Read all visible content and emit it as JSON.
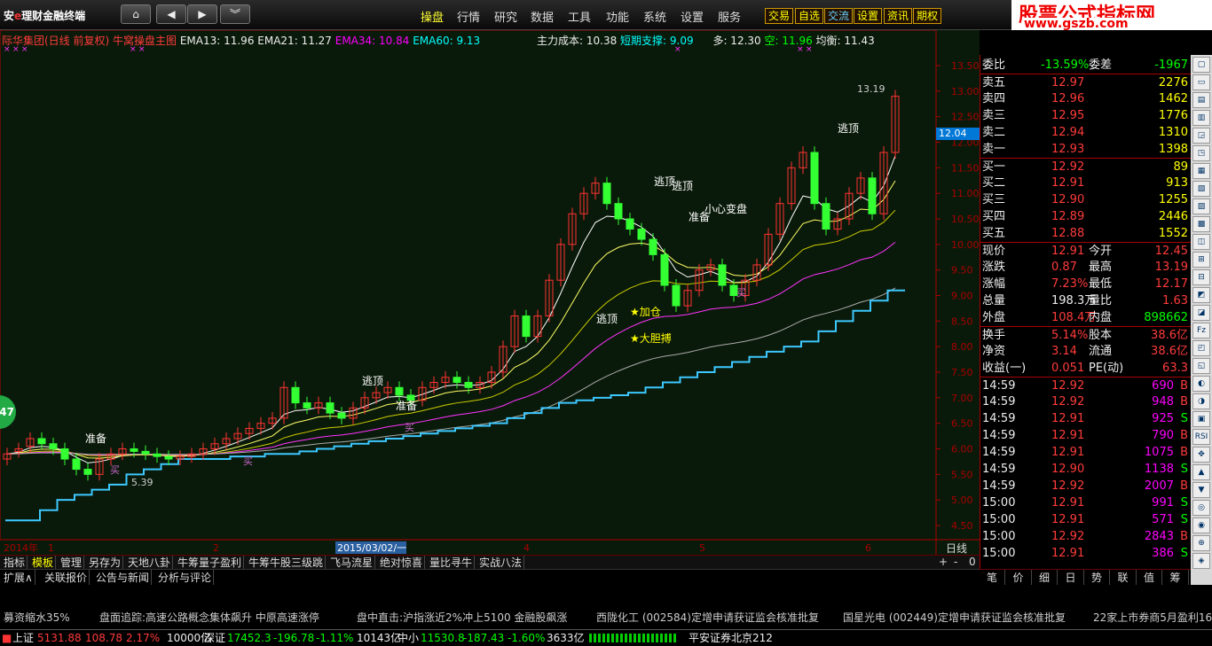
{
  "app": {
    "logo_prefix": "安",
    "logo_e": "e",
    "logo_text": "理财金融终端"
  },
  "menus": [
    "操盘",
    "行情",
    "研究",
    "数据",
    "工具",
    "功能",
    "系统",
    "设置",
    "服务"
  ],
  "active_menu": "操盘",
  "trade_buttons": [
    "交易",
    "自选",
    "交流",
    "设置",
    "资讯",
    "期权"
  ],
  "brand": {
    "line1": "股票公式指标网",
    "line2": "www.gszb.com"
  },
  "chart": {
    "title": "际华集团(日线 前复权) 牛窝操盘主图",
    "ema13": "EMA13: 11.96",
    "ema21": "EMA21: 11.27",
    "ema34": "EMA34: 10.84",
    "ema60": "EMA60: 9.13",
    "cost": "主力成本: 10.38",
    "support": "短期支撑: 9.09",
    "long": "多: 12.30",
    "short": "空: 11.96",
    "balance": "均衡: 11.43",
    "current_price_tag": "12.04",
    "period_label": "日线",
    "x_labels": [
      "2014年",
      "1",
      "2",
      "2015/03/02/一",
      "4",
      "5",
      "6"
    ],
    "annotations": {
      "escape": "逃顶",
      "prepare": "准备",
      "careful": "小心变盘",
      "add": "加仓",
      "bold": "大胆搏",
      "buy": "买",
      "high": "13.19",
      "low": "5.39"
    }
  },
  "chart_data": {
    "type": "candlestick",
    "ylim": [
      4.5,
      13.5
    ],
    "y_ticks": [
      "13.50",
      "13.00",
      "12.50",
      "12.00",
      "11.50",
      "11.00",
      "10.50",
      "10.00",
      "9.50",
      "9.00",
      "8.50",
      "8.00",
      "7.50",
      "7.00",
      "6.50",
      "6.00",
      "5.50",
      "5.00",
      "4.50"
    ],
    "close": [
      5.9,
      6.0,
      6.2,
      6.1,
      6.0,
      5.8,
      5.6,
      5.5,
      5.8,
      5.9,
      6.0,
      5.95,
      5.9,
      5.85,
      5.8,
      5.85,
      5.9,
      6.0,
      6.1,
      6.2,
      6.3,
      6.4,
      6.5,
      6.6,
      7.2,
      6.9,
      6.8,
      6.9,
      6.7,
      6.6,
      6.8,
      7.0,
      7.1,
      7.2,
      7.05,
      6.95,
      7.2,
      7.3,
      7.4,
      7.3,
      7.2,
      7.3,
      7.5,
      8.0,
      8.6,
      8.2,
      8.6,
      9.3,
      10.0,
      10.6,
      11.0,
      11.2,
      10.8,
      10.5,
      10.3,
      10.1,
      9.8,
      9.2,
      8.8,
      9.1,
      9.5,
      9.6,
      9.2,
      9.0,
      9.3,
      9.6,
      10.2,
      10.8,
      11.5,
      11.8,
      10.8,
      10.3,
      10.5,
      11.0,
      11.3,
      10.6,
      11.8,
      12.9
    ],
    "open": [
      5.8,
      5.95,
      6.05,
      6.2,
      6.1,
      6.0,
      5.8,
      5.6,
      5.5,
      5.8,
      5.9,
      6.0,
      5.95,
      5.9,
      5.85,
      5.8,
      5.85,
      5.9,
      6.0,
      6.1,
      6.2,
      6.3,
      6.4,
      6.5,
      6.6,
      7.2,
      6.9,
      6.8,
      6.9,
      6.7,
      6.6,
      6.8,
      7.0,
      7.1,
      7.2,
      7.05,
      6.95,
      7.2,
      7.3,
      7.4,
      7.3,
      7.2,
      7.3,
      7.5,
      8.0,
      8.6,
      8.2,
      8.6,
      9.3,
      10.0,
      10.6,
      11.0,
      11.2,
      10.8,
      10.5,
      10.3,
      10.1,
      9.8,
      9.2,
      8.8,
      9.1,
      9.5,
      9.6,
      9.2,
      9.0,
      9.3,
      9.6,
      10.2,
      10.8,
      11.5,
      11.8,
      10.8,
      10.3,
      10.5,
      11.0,
      11.3,
      10.6,
      11.8
    ],
    "support_line": [
      4.6,
      4.6,
      4.8,
      5.0,
      5.1,
      5.2,
      5.3,
      5.5,
      5.6,
      5.7,
      5.8,
      5.8,
      5.8,
      5.85,
      5.85,
      5.9,
      5.9,
      5.95,
      6.0,
      6.05,
      6.1,
      6.15,
      6.2,
      6.25,
      6.3,
      6.35,
      6.4,
      6.45,
      6.5,
      6.6,
      6.7,
      6.8,
      6.9,
      6.95,
      7.0,
      7.05,
      7.1,
      7.2,
      7.3,
      7.4,
      7.5,
      7.6,
      7.7,
      7.8,
      7.9,
      8.0,
      8.1,
      8.3,
      8.5,
      8.7,
      8.9,
      9.1
    ]
  },
  "quote": {
    "weibi_label": "委比",
    "weibi": "-13.59%",
    "weicha_label": "委差",
    "weicha": "-1967",
    "asks": [
      {
        "label": "卖五",
        "price": "12.97",
        "vol": "2276"
      },
      {
        "label": "卖四",
        "price": "12.96",
        "vol": "1462"
      },
      {
        "label": "卖三",
        "price": "12.95",
        "vol": "1776"
      },
      {
        "label": "卖二",
        "price": "12.94",
        "vol": "1310"
      },
      {
        "label": "卖一",
        "price": "12.93",
        "vol": "1398"
      }
    ],
    "bids": [
      {
        "label": "买一",
        "price": "12.92",
        "vol": "89"
      },
      {
        "label": "买二",
        "price": "12.91",
        "vol": "913"
      },
      {
        "label": "买三",
        "price": "12.90",
        "vol": "1255"
      },
      {
        "label": "买四",
        "price": "12.89",
        "vol": "2446"
      },
      {
        "label": "买五",
        "price": "12.88",
        "vol": "1552"
      }
    ],
    "stats": [
      {
        "l1": "现价",
        "v1": "12.91",
        "c1": "red",
        "l2": "今开",
        "v2": "12.45",
        "c2": "red"
      },
      {
        "l1": "涨跌",
        "v1": "0.87",
        "c1": "red",
        "l2": "最高",
        "v2": "13.19",
        "c2": "red"
      },
      {
        "l1": "涨幅",
        "v1": "7.23%",
        "c1": "red",
        "l2": "最低",
        "v2": "12.17",
        "c2": "red"
      },
      {
        "l1": "总量",
        "v1": "198.3万",
        "c1": "white",
        "l2": "量比",
        "v2": "1.63",
        "c2": "red"
      },
      {
        "l1": "外盘",
        "v1": "108.4万",
        "c1": "red",
        "l2": "内盘",
        "v2": "898662",
        "c2": "green"
      },
      {
        "l1": "换手",
        "v1": "5.14%",
        "c1": "red",
        "l2": "股本",
        "v2": "38.6亿",
        "c2": "red"
      },
      {
        "l1": "净资",
        "v1": "3.14",
        "c1": "red",
        "l2": "流通",
        "v2": "38.6亿",
        "c2": "red"
      },
      {
        "l1": "收益(一)",
        "v1": "0.051",
        "c1": "red",
        "l2": "PE(动)",
        "v2": "63.3",
        "c2": "red"
      }
    ],
    "ticks": [
      {
        "t": "14:59",
        "p": "12.92",
        "v": "690",
        "s": "B"
      },
      {
        "t": "14:59",
        "p": "12.92",
        "v": "948",
        "s": "B"
      },
      {
        "t": "14:59",
        "p": "12.91",
        "v": "925",
        "s": "S"
      },
      {
        "t": "14:59",
        "p": "12.91",
        "v": "790",
        "s": "B"
      },
      {
        "t": "14:59",
        "p": "12.91",
        "v": "1075",
        "s": "B"
      },
      {
        "t": "14:59",
        "p": "12.90",
        "v": "1138",
        "s": "S"
      },
      {
        "t": "14:59",
        "p": "12.92",
        "v": "2007",
        "s": "B"
      },
      {
        "t": "15:00",
        "p": "12.91",
        "v": "991",
        "s": "S"
      },
      {
        "t": "15:00",
        "p": "12.91",
        "v": "571",
        "s": "S"
      },
      {
        "t": "15:00",
        "p": "12.92",
        "v": "2843",
        "s": "B"
      },
      {
        "t": "15:00",
        "p": "12.91",
        "v": "386",
        "s": "S"
      }
    ]
  },
  "bottom_tabs": [
    "指标",
    "模板",
    "管理",
    "另存为",
    "天地八卦",
    "牛筹量子盈利",
    "牛筹牛股三级跳",
    "飞马流星",
    "绝对惊喜",
    "量比寻牛",
    "实战八法"
  ],
  "bottom_tabs2": [
    "扩展∧",
    "关联报价",
    "公告与新闻",
    "分析与评论"
  ],
  "right_tabs": [
    "笔",
    "价",
    "细",
    "日",
    "势",
    "联",
    "值",
    "筹"
  ],
  "news": [
    "募资缩水35%",
    "盘面追踪:高速公路概念集体飙升  中原高速涨停",
    "盘中直击:沪指涨近2%冲上5100  金融股飙涨",
    "西陇化工 (002584)定增申请获证监会核准批复",
    "国星光电 (002449)定增申请获证监会核准批复",
    "22家上市券商5月盈利166"
  ],
  "status": {
    "sh_label": "上证",
    "sh_val": "5131.88",
    "sh_chg": "108.78",
    "sh_pct": "2.17%",
    "sh_amt": "10000亿",
    "sz_label": "深证",
    "sz_val": "17452.3",
    "sz_chg": "-196.78",
    "sz_pct": "-1.11%",
    "sz_amt": "10143亿",
    "zx_label": "中小",
    "zx_val": "11530.8",
    "zx_chg": "-187.43",
    "zx_pct": "-1.60%",
    "zx_amt": "3633亿",
    "broker": "平安证券北京212"
  },
  "badge": "47"
}
